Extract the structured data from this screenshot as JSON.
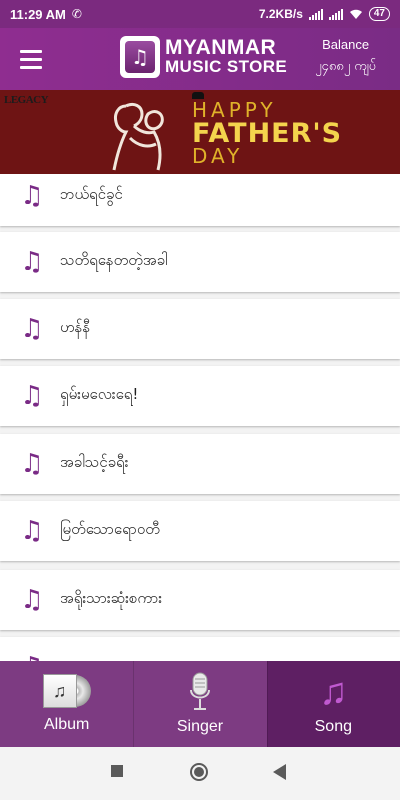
{
  "status_bar": {
    "time": "11:29 AM",
    "network_speed": "7.2KB/s",
    "battery": "47",
    "icons": [
      "call-icon",
      "signal-icon",
      "wifi-icon",
      "battery-icon"
    ]
  },
  "header": {
    "menu_icon": "hamburger-menu-icon",
    "logo_line1": "MYANMAR",
    "logo_line2": "MUSIC STORE",
    "balance_label": "Balance",
    "balance_value": "၂၄၈၈၂ ကျပ်"
  },
  "banner": {
    "brand": "LEGACY",
    "line1": "HAPPY",
    "line2": "FATHER'S",
    "line3": "DAY"
  },
  "songs": [
    {
      "title": "ဘယ်ရင်ခွင်"
    },
    {
      "title": "သတိရနေတတဲ့အခါ"
    },
    {
      "title": "ဟန်နီ"
    },
    {
      "title": "ရှမ်းမလေးရေ!"
    },
    {
      "title": "အခါသင့်ခရီး"
    },
    {
      "title": "မြတ်သောရောဝတီ"
    },
    {
      "title": "အရိုးသားဆုံးစကား"
    }
  ],
  "bottom_nav": {
    "tabs": [
      {
        "label": "Album",
        "icon": "album-icon",
        "active": false
      },
      {
        "label": "Singer",
        "icon": "microphone-icon",
        "active": false
      },
      {
        "label": "Song",
        "icon": "music-note-icon",
        "active": true
      }
    ]
  },
  "colors": {
    "primary": "#8f2d90",
    "nav": "#7d3b82",
    "nav_active": "#5e1f63",
    "banner": "#6e1414",
    "note": "#7a2b86"
  }
}
